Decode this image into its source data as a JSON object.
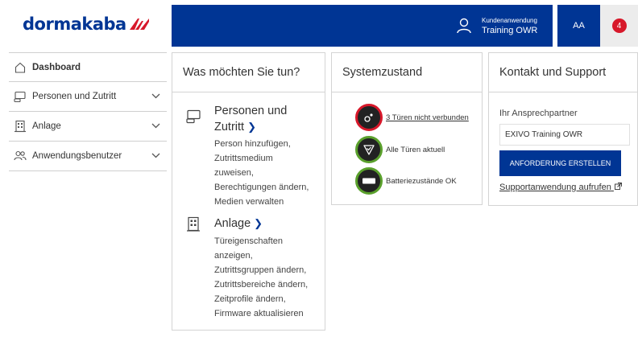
{
  "brand": {
    "logo_text": "dormakaba"
  },
  "header": {
    "app_label_small": "Kundenanwendung",
    "app_name": "Training OWR",
    "user_initials": "AA",
    "notification_count": "4"
  },
  "sidebar": {
    "items": [
      {
        "label": "Dashboard",
        "icon": "home-icon",
        "active": true
      },
      {
        "label": "Personen und Zutritt",
        "icon": "person-card-icon"
      },
      {
        "label": "Anlage",
        "icon": "building-icon"
      },
      {
        "label": "Anwendungsbenutzer",
        "icon": "users-icon"
      }
    ]
  },
  "actions_card": {
    "title": "Was möchten Sie tun?",
    "items": [
      {
        "title_line1": "Personen und",
        "title_line2": "Zutritt",
        "desc": [
          "Person hinzufügen,",
          "Zutrittsmedium",
          "zuweisen,",
          "Berechtigungen ändern,",
          "Medien verwalten"
        ]
      },
      {
        "title_line1": "Anlage",
        "desc": [
          "Türeigenschaften",
          "anzeigen,",
          "Zutrittsgruppen ändern,",
          "Zutrittsbereiche ändern,",
          "Zeitprofile ändern,",
          "Firmware aktualisieren"
        ]
      }
    ]
  },
  "system_card": {
    "title": "Systemzustand",
    "items": [
      {
        "text": "3 Türen nicht verbunden",
        "status": "error"
      },
      {
        "text": "Alle Türen aktuell",
        "status": "ok"
      },
      {
        "text": "Batteriezustände OK",
        "status": "ok"
      }
    ]
  },
  "contact_card": {
    "title": "Kontakt und Support",
    "partner_label": "Ihr Ansprechpartner",
    "partner_value": "EXIVO Training OWR",
    "request_button": "ANFORDERUNG ERSTELLEN",
    "support_link": "Supportanwendung aufrufen"
  },
  "colors": {
    "brand_blue": "#003594",
    "alert_red": "#d7182a",
    "ok_green": "#5aa02c"
  }
}
